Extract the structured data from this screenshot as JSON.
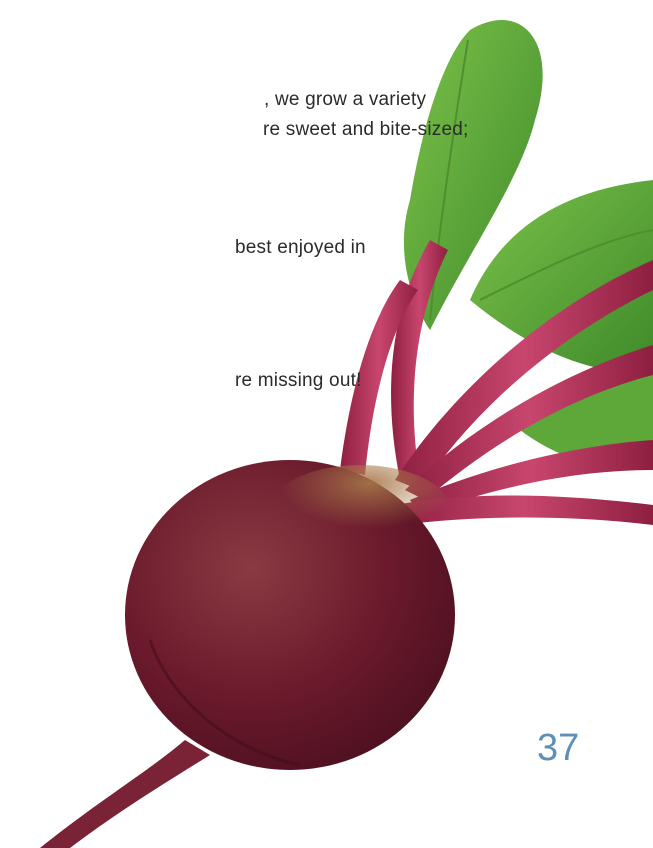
{
  "body_text": {
    "line1": ", we grow a variety",
    "line2": "re sweet and bite-sized;",
    "line3": "best enjoyed in",
    "line4": "re missing out!"
  },
  "page_number": "37",
  "image": {
    "subject": "beetroot-icon",
    "colors": {
      "root": "#6b1a2c",
      "root_highlight": "#8a2c3e",
      "root_top": "#9a6a3c",
      "stem": "#a8294e",
      "stem_light": "#d9658a",
      "leaf": "#5ea83a",
      "leaf_dark": "#3f8a2a"
    }
  }
}
